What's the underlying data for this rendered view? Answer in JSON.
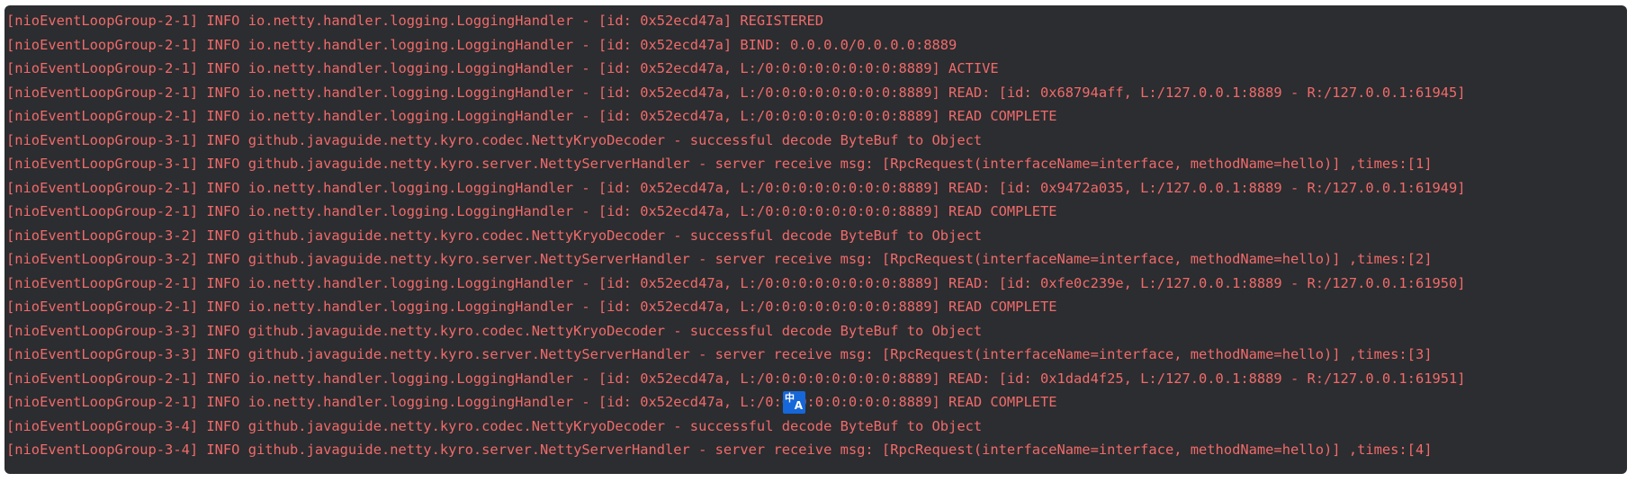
{
  "console": {
    "lines": [
      "[nioEventLoopGroup-2-1] INFO io.netty.handler.logging.LoggingHandler - [id: 0x52ecd47a] REGISTERED",
      "[nioEventLoopGroup-2-1] INFO io.netty.handler.logging.LoggingHandler - [id: 0x52ecd47a] BIND: 0.0.0.0/0.0.0.0:8889",
      "[nioEventLoopGroup-2-1] INFO io.netty.handler.logging.LoggingHandler - [id: 0x52ecd47a, L:/0:0:0:0:0:0:0:0:8889] ACTIVE",
      "[nioEventLoopGroup-2-1] INFO io.netty.handler.logging.LoggingHandler - [id: 0x52ecd47a, L:/0:0:0:0:0:0:0:0:8889] READ: [id: 0x68794aff, L:/127.0.0.1:8889 - R:/127.0.0.1:61945]",
      "[nioEventLoopGroup-2-1] INFO io.netty.handler.logging.LoggingHandler - [id: 0x52ecd47a, L:/0:0:0:0:0:0:0:0:8889] READ COMPLETE",
      "[nioEventLoopGroup-3-1] INFO github.javaguide.netty.kyro.codec.NettyKryoDecoder - successful decode ByteBuf to Object",
      "[nioEventLoopGroup-3-1] INFO github.javaguide.netty.kyro.server.NettyServerHandler - server receive msg: [RpcRequest(interfaceName=interface, methodName=hello)] ,times:[1]",
      "[nioEventLoopGroup-2-1] INFO io.netty.handler.logging.LoggingHandler - [id: 0x52ecd47a, L:/0:0:0:0:0:0:0:0:8889] READ: [id: 0x9472a035, L:/127.0.0.1:8889 - R:/127.0.0.1:61949]",
      "[nioEventLoopGroup-2-1] INFO io.netty.handler.logging.LoggingHandler - [id: 0x52ecd47a, L:/0:0:0:0:0:0:0:0:8889] READ COMPLETE",
      "[nioEventLoopGroup-3-2] INFO github.javaguide.netty.kyro.codec.NettyKryoDecoder - successful decode ByteBuf to Object",
      "[nioEventLoopGroup-3-2] INFO github.javaguide.netty.kyro.server.NettyServerHandler - server receive msg: [RpcRequest(interfaceName=interface, methodName=hello)] ,times:[2]",
      "[nioEventLoopGroup-2-1] INFO io.netty.handler.logging.LoggingHandler - [id: 0x52ecd47a, L:/0:0:0:0:0:0:0:0:8889] READ: [id: 0xfe0c239e, L:/127.0.0.1:8889 - R:/127.0.0.1:61950]",
      "[nioEventLoopGroup-2-1] INFO io.netty.handler.logging.LoggingHandler - [id: 0x52ecd47a, L:/0:0:0:0:0:0:0:0:8889] READ COMPLETE",
      "[nioEventLoopGroup-3-3] INFO github.javaguide.netty.kyro.codec.NettyKryoDecoder - successful decode ByteBuf to Object",
      "[nioEventLoopGroup-3-3] INFO github.javaguide.netty.kyro.server.NettyServerHandler - server receive msg: [RpcRequest(interfaceName=interface, methodName=hello)] ,times:[3]",
      "[nioEventLoopGroup-2-1] INFO io.netty.handler.logging.LoggingHandler - [id: 0x52ecd47a, L:/0:0:0:0:0:0:0:0:8889] READ: [id: 0x1dad4f25, L:/127.0.0.1:8889 - R:/127.0.0.1:61951]",
      "[nioEventLoopGroup-2-1] INFO io.netty.handler.logging.LoggingHandler - [id: 0x52ecd47a, L:/0:0:0:0:0:0:0:0:8889] READ COMPLETE",
      "[nioEventLoopGroup-3-4] INFO github.javaguide.netty.kyro.codec.NettyKryoDecoder - successful decode ByteBuf to Object",
      "[nioEventLoopGroup-3-4] INFO github.javaguide.netty.kyro.server.NettyServerHandler - server receive msg: [RpcRequest(interfaceName=interface, methodName=hello)] ,times:[4]"
    ]
  },
  "overlay": {
    "icon": "translate-icon",
    "zh_glyph": "中",
    "a_glyph": "A"
  },
  "colors": {
    "background": "#2b2d30",
    "log_text": "#f16a6a",
    "translate_icon": "#1667d9"
  }
}
